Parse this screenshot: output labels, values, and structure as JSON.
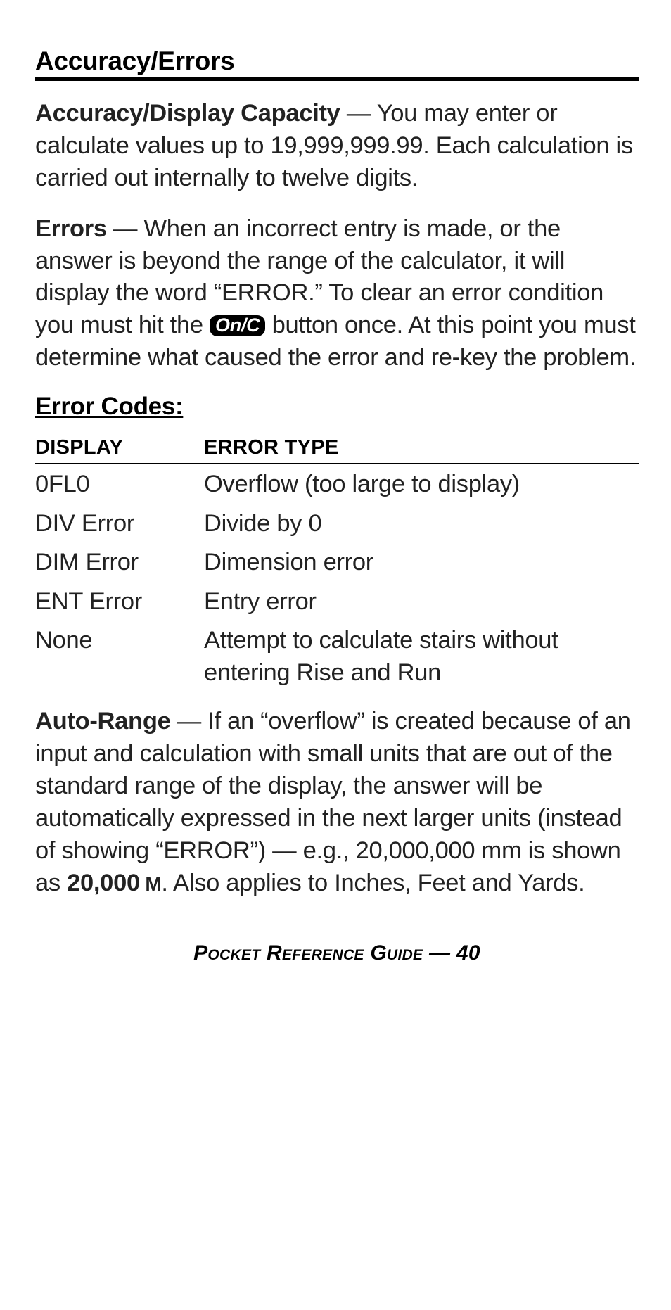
{
  "section_title": "Accuracy/Errors",
  "para1_lead": "Accuracy/Display Capacity",
  "para1_dash": " — ",
  "para1_body": "You may enter or calculate values up to 19,999,999.99. Each calculation is carried out internally to twelve digits.",
  "para2_lead": "Errors",
  "para2_before_key": " — When an incorrect entry is made, or the answer is beyond the range of the calculator, it will display the word “ERROR.” To clear an error condition you must hit the ",
  "key_label": "On/C",
  "para2_after_key": " button once. At this point you must determine what caused the error and re-key the problem.",
  "subhead": "Error Codes:",
  "table": {
    "headers": {
      "display": "DISPLAY",
      "error_type": "ERROR TYPE"
    },
    "rows": [
      {
        "display": "0FL0",
        "error_type": "Overflow (too large to display)"
      },
      {
        "display": "DIV Error",
        "error_type": "Divide by 0"
      },
      {
        "display": "DIM Error",
        "error_type": "Dimension error"
      },
      {
        "display": "ENT Error",
        "error_type": "Entry error"
      },
      {
        "display": "None",
        "error_type": "Attempt to calculate stairs without entering Rise and Run"
      }
    ]
  },
  "para3_lead": "Auto-Range",
  "para3_body_before_bold": " — If an “overflow” is created because of an input and calculation with small units that are out of the standard range of the display, the answer will be automatically expressed in the next larger units (instead of showing “ERROR”) — e.g., 20,000,000 mm is shown as ",
  "para3_bold_value": "20,000",
  "para3_unit": " M",
  "para3_tail": ". Also applies to Inches, Feet and Yards.",
  "footer_label": "Pocket Reference Guide — ",
  "footer_page": "40"
}
